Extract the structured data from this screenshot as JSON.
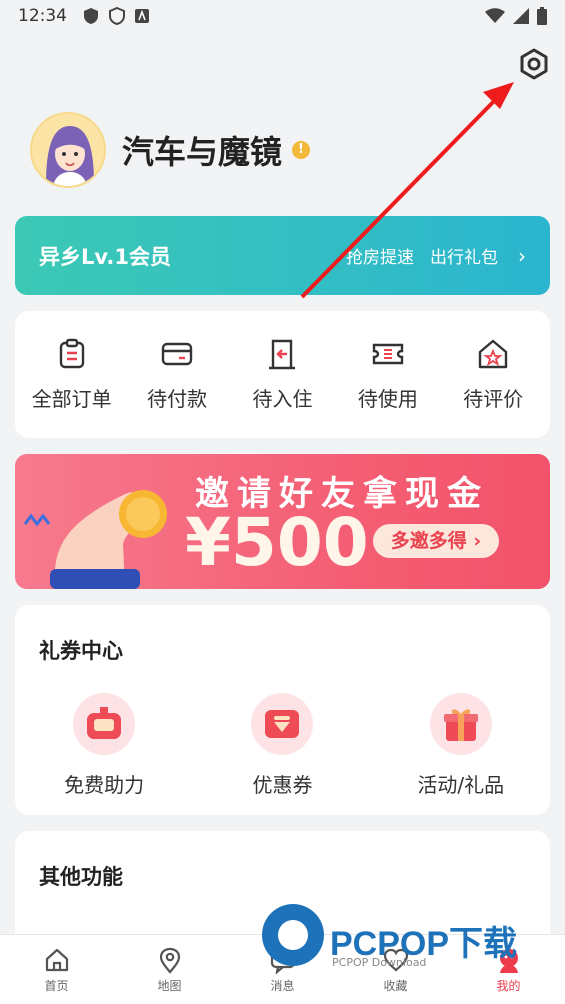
{
  "status_bar": {
    "time": "12:34"
  },
  "profile": {
    "name": "汽车与魔镜",
    "warning_icon": "info-icon"
  },
  "membership": {
    "level": "异乡Lv.1会员",
    "benefits": [
      "抢房提速",
      "出行礼包"
    ],
    "chevron": "›"
  },
  "orders": {
    "items": [
      {
        "label": "全部订单",
        "icon": "clipboard-icon"
      },
      {
        "label": "待付款",
        "icon": "card-icon"
      },
      {
        "label": "待入住",
        "icon": "door-icon"
      },
      {
        "label": "待使用",
        "icon": "ticket-icon"
      },
      {
        "label": "待评价",
        "icon": "star-house-icon"
      }
    ]
  },
  "banner": {
    "title": "邀请好友拿现金",
    "amount": "¥500",
    "cta": "多邀多得 ›"
  },
  "coupons": {
    "title": "礼券中心",
    "items": [
      {
        "label": "免费助力",
        "icon": "robot-icon"
      },
      {
        "label": "优惠券",
        "icon": "coupon-icon"
      },
      {
        "label": "活动/礼品",
        "icon": "gift-icon"
      }
    ]
  },
  "other": {
    "title": "其他功能"
  },
  "tabbar": {
    "items": [
      {
        "label": "首页",
        "icon": "home-icon"
      },
      {
        "label": "地图",
        "icon": "map-pin-icon"
      },
      {
        "label": "消息",
        "icon": "message-icon"
      },
      {
        "label": "收藏",
        "icon": "heart-icon"
      },
      {
        "label": "我的",
        "icon": "profile-icon",
        "active": true
      }
    ]
  },
  "watermark": {
    "text": "PCPOP下载",
    "sub": "PCPOP Download"
  },
  "colors": {
    "accent": "#ee3b4c",
    "member": "#2bb5cf",
    "banner": "#f45f74"
  }
}
